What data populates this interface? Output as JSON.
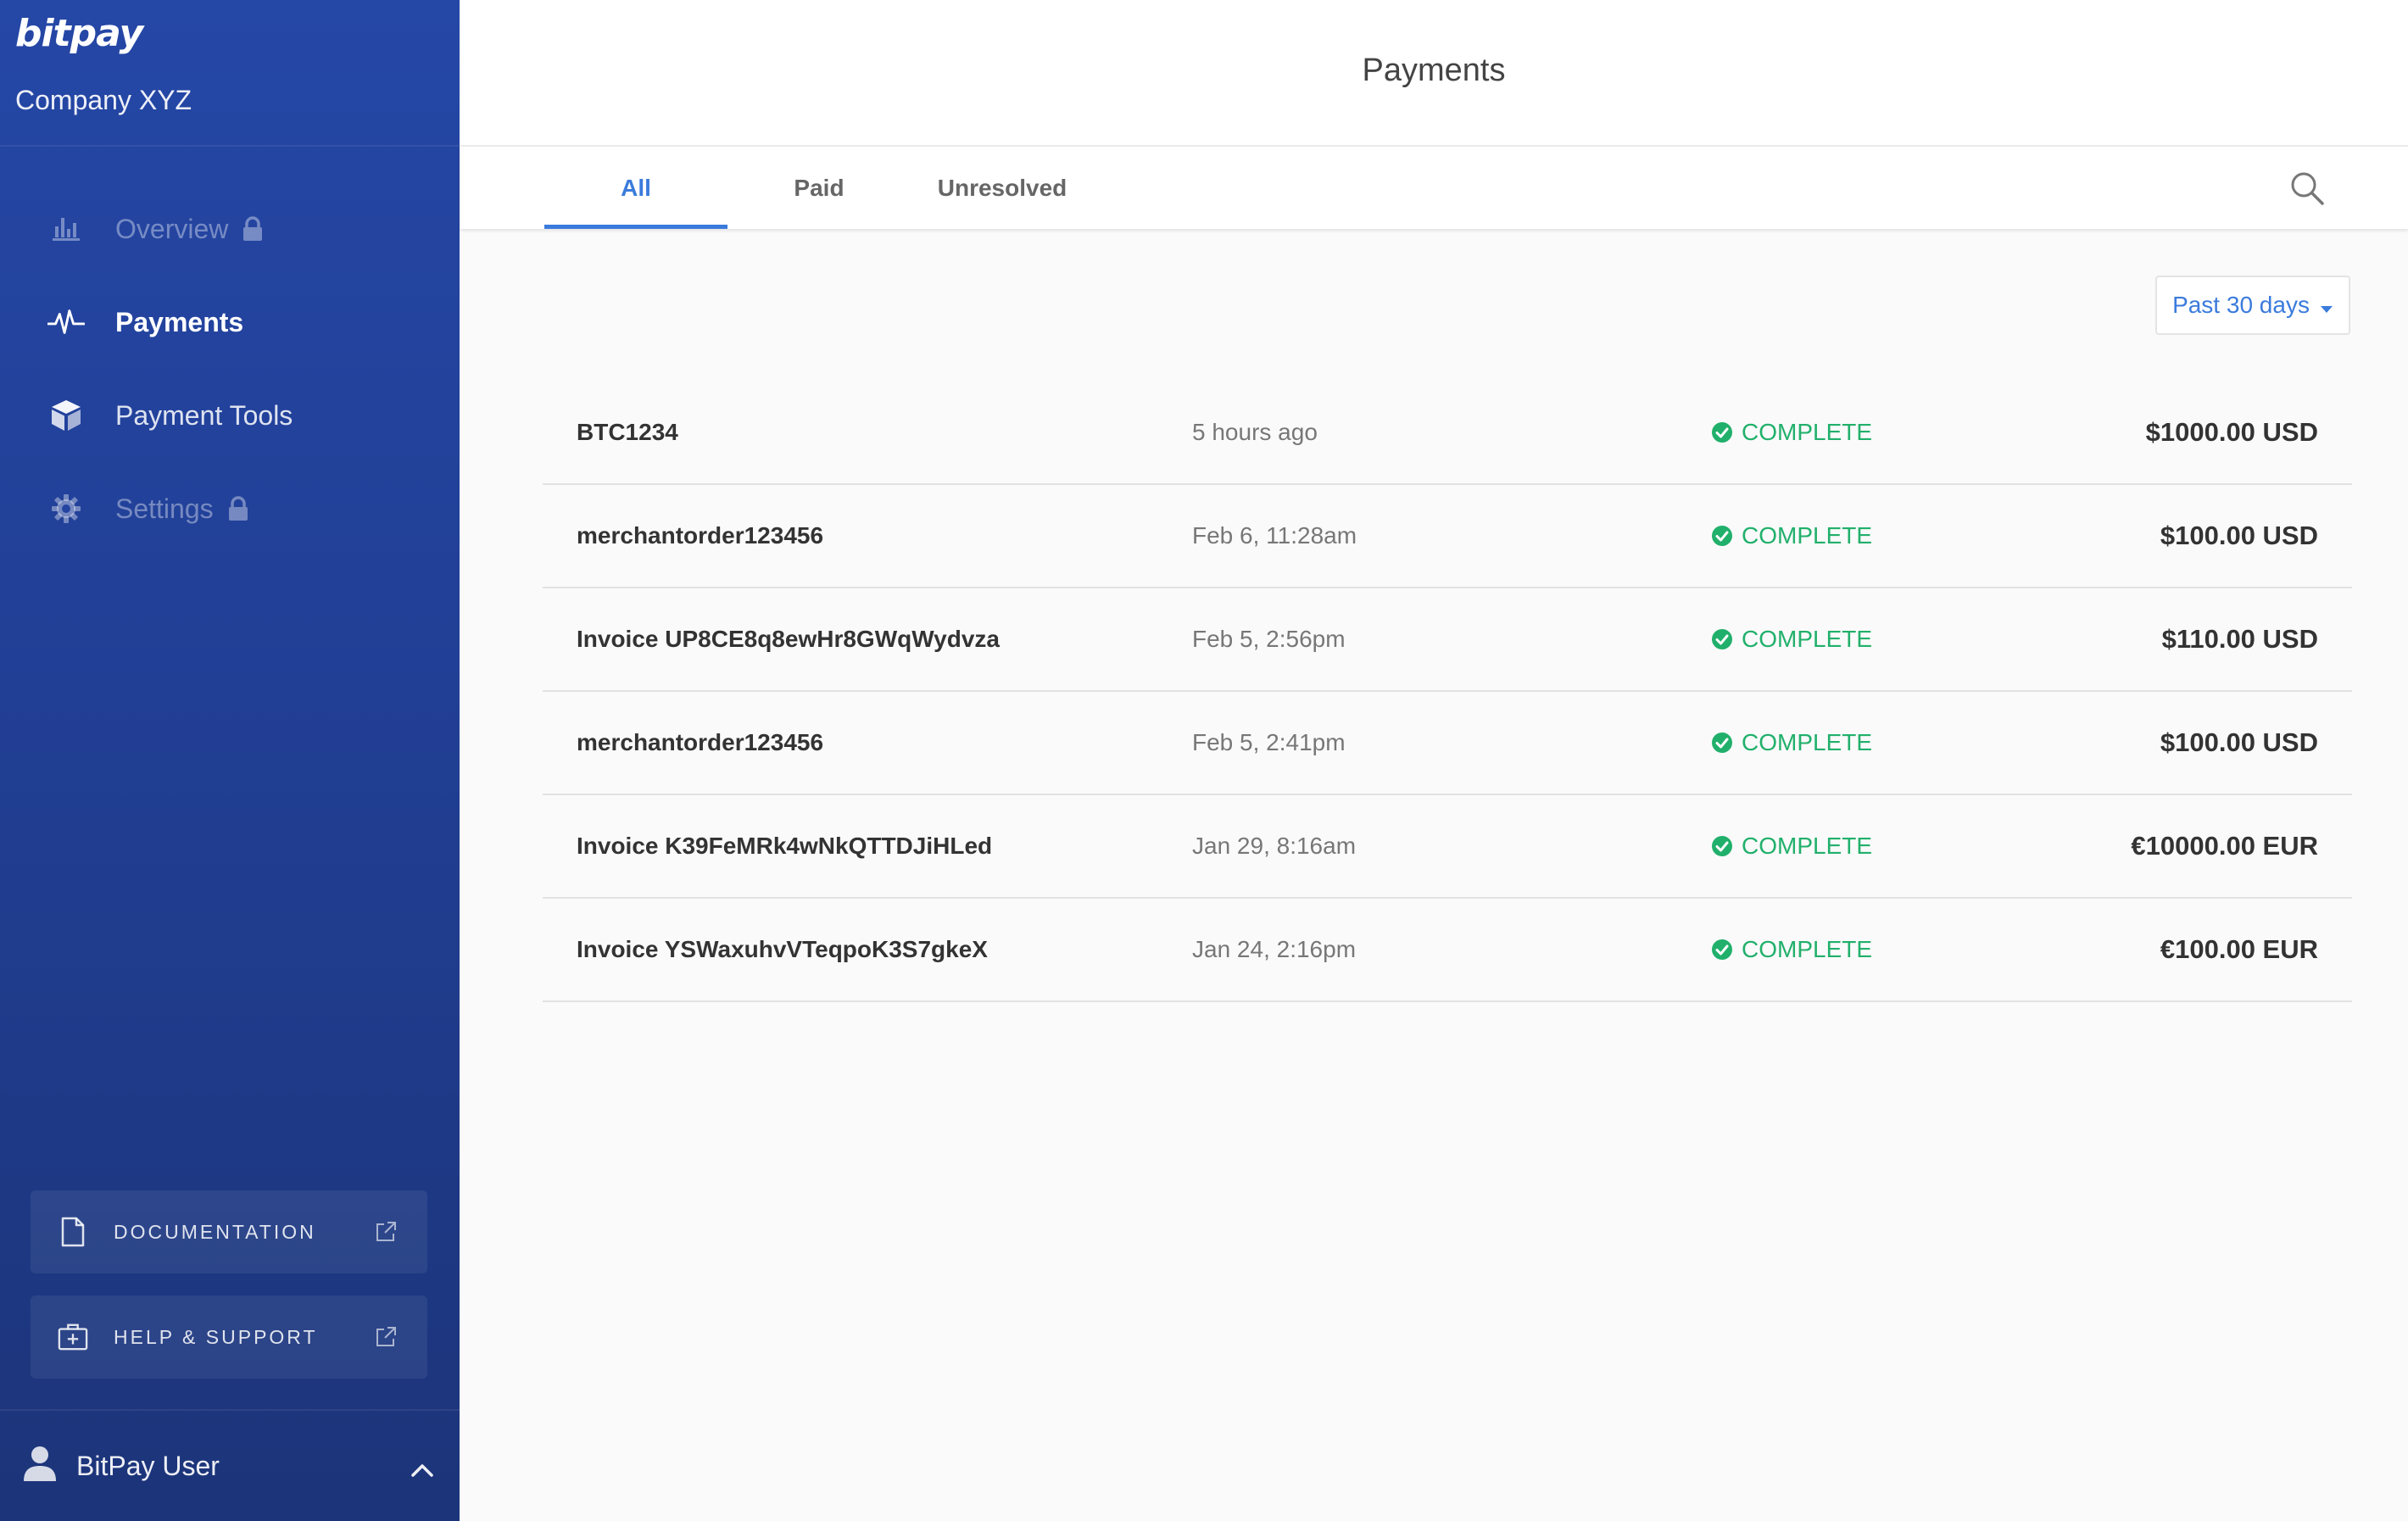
{
  "sidebar": {
    "logo": "bitpay",
    "company": "Company XYZ",
    "nav": [
      {
        "label": "Overview",
        "icon": "bar-chart-icon",
        "state": "disabled",
        "locked": true
      },
      {
        "label": "Payments",
        "icon": "pulse-icon",
        "state": "active",
        "locked": false
      },
      {
        "label": "Payment Tools",
        "icon": "cube-icon",
        "state": "normal",
        "locked": false
      },
      {
        "label": "Settings",
        "icon": "gear-icon",
        "state": "disabled",
        "locked": true
      }
    ],
    "documentation": "DOCUMENTATION",
    "help": "HELP & SUPPORT",
    "user": "BitPay User"
  },
  "header": {
    "title": "Payments"
  },
  "tabs": [
    "All",
    "Paid",
    "Unresolved"
  ],
  "filter": {
    "range": "Past 30 days"
  },
  "payments": [
    {
      "id": "BTC1234",
      "date": "5 hours ago",
      "status": "COMPLETE",
      "amount": "$1000.00 USD"
    },
    {
      "id": "merchantorder123456",
      "date": "Feb 6, 11:28am",
      "status": "COMPLETE",
      "amount": "$100.00 USD"
    },
    {
      "id": "Invoice UP8CE8q8ewHr8GWqWydvza",
      "date": "Feb 5, 2:56pm",
      "status": "COMPLETE",
      "amount": "$110.00 USD"
    },
    {
      "id": "merchantorder123456",
      "date": "Feb 5, 2:41pm",
      "status": "COMPLETE",
      "amount": "$100.00 USD"
    },
    {
      "id": "Invoice K39FeMRk4wNkQTTDJiHLed",
      "date": "Jan 29, 8:16am",
      "status": "COMPLETE",
      "amount": "€10000.00 EUR"
    },
    {
      "id": "Invoice YSWaxuhvVTeqpoK3S7gkeX",
      "date": "Jan 24, 2:16pm",
      "status": "COMPLETE",
      "amount": "€100.00 EUR"
    }
  ],
  "colors": {
    "accent": "#3b7bdc",
    "success": "#21b06b",
    "sidebar_top": "#2547a6",
    "sidebar_bottom": "#1c3479"
  }
}
